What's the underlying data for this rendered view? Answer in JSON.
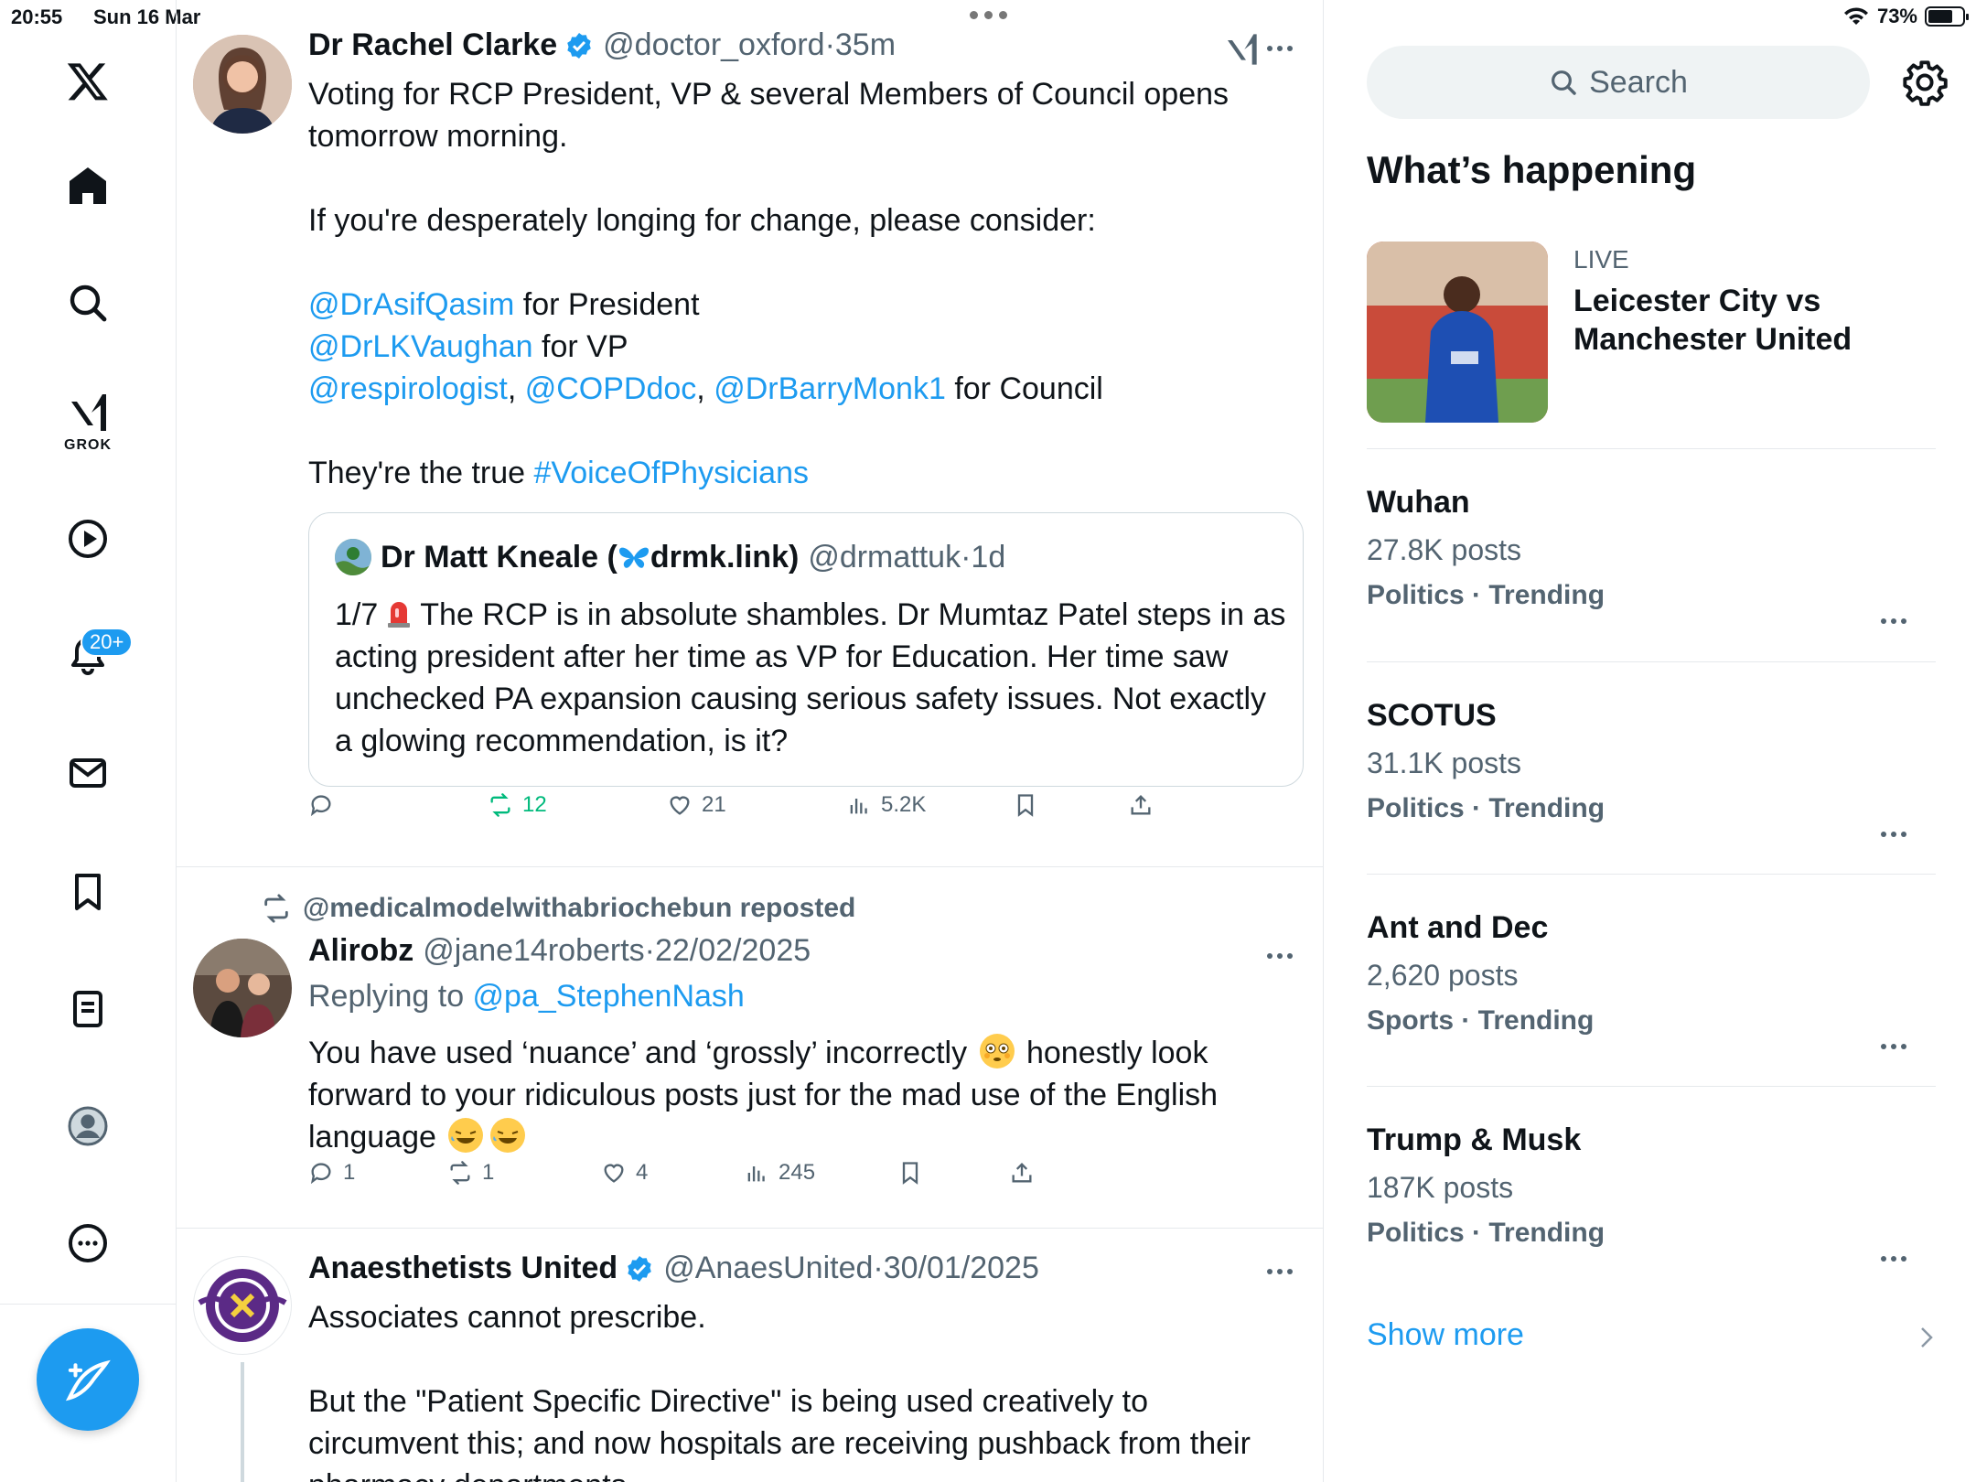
{
  "status_bar": {
    "time": "20:55",
    "date": "Sun 16 Mar",
    "battery": "73%",
    "battery_level": 0.73
  },
  "nav": {
    "grok_label": "GROK",
    "notifications_badge": "20+"
  },
  "tweets": [
    {
      "name": "Dr Rachel Clarke",
      "handle": "@doctor_oxford",
      "time": "·35m",
      "lines": [
        "Voting for RCP President, VP & several Members of Council opens tomorrow morning.",
        "If you're desperately longing for change, please consider:"
      ],
      "mention1": "@DrAsifQasim",
      "mention1_text": " for President",
      "mention2": "@DrLKVaughan",
      "mention2_text": " for VP",
      "mention3": "@respirologist",
      "mention4": "@COPDdoc",
      "mention5": "@DrBarryMonk1",
      "sep": ", ",
      "mention5_text": " for Council",
      "closing": "They're the true ",
      "hashtag": "#VoiceOfPhysicians",
      "quote": {
        "name_prefix": "Dr Matt Kneale (",
        "name_suffix": "drmk.link)",
        "handle": "@drmattuk",
        "time": "·1d",
        "text_prefix": "1/7",
        "text": "The RCP is in absolute shambles. Dr Mumtaz Patel steps in as acting president after her time as VP for Education. Her time saw unchecked PA expansion causing serious safety issues. Not exactly a glowing recommendation, is it?"
      },
      "actions": {
        "replies": "",
        "reposts": "12",
        "likes": "21",
        "views": "5.2K"
      }
    },
    {
      "reposted_by": "@medicalmodelwithabriochebun reposted",
      "name": "Alirobz",
      "handle": "@jane14roberts",
      "time": "·22/02/2025",
      "replying_label": "Replying to ",
      "replying_handle": "@pa_StephenNash",
      "text_a": "You have used ‘nuance’ and ‘grossly’ incorrectly",
      "text_b": " honestly look forward to your ridiculous posts just for the mad use of the English language ",
      "actions": {
        "replies": "1",
        "reposts": "1",
        "likes": "4",
        "views": "245"
      }
    },
    {
      "name": "Anaesthetists United",
      "handle": "@AnaesUnited",
      "time": "·30/01/2025",
      "line1": "Associates cannot prescribe.",
      "line2": "But the \"Patient Specific Directive\" is being used creatively to circumvent this; and now hospitals are receiving pushback from their pharmacy departments."
    }
  ],
  "sidebar": {
    "search_placeholder": "Search",
    "whats_happening": "What’s happening",
    "live": {
      "label": "LIVE",
      "title": "Leicester City vs Manchester United"
    },
    "trends": [
      {
        "name": "Wuhan",
        "count": "27.8K posts",
        "category": "Politics · Trending"
      },
      {
        "name": "SCOTUS",
        "count": "31.1K posts",
        "category": "Politics · Trending"
      },
      {
        "name": "Ant and Dec",
        "count": "2,620 posts",
        "category": "Sports · Trending"
      },
      {
        "name": "Trump & Musk",
        "count": "187K posts",
        "category": "Politics · Trending"
      }
    ],
    "show_more": "Show more"
  },
  "colors": {
    "accent": "#1d9bf0",
    "text": "#0f1419",
    "secondary": "#536471",
    "repost_green": "#00ba7c"
  }
}
